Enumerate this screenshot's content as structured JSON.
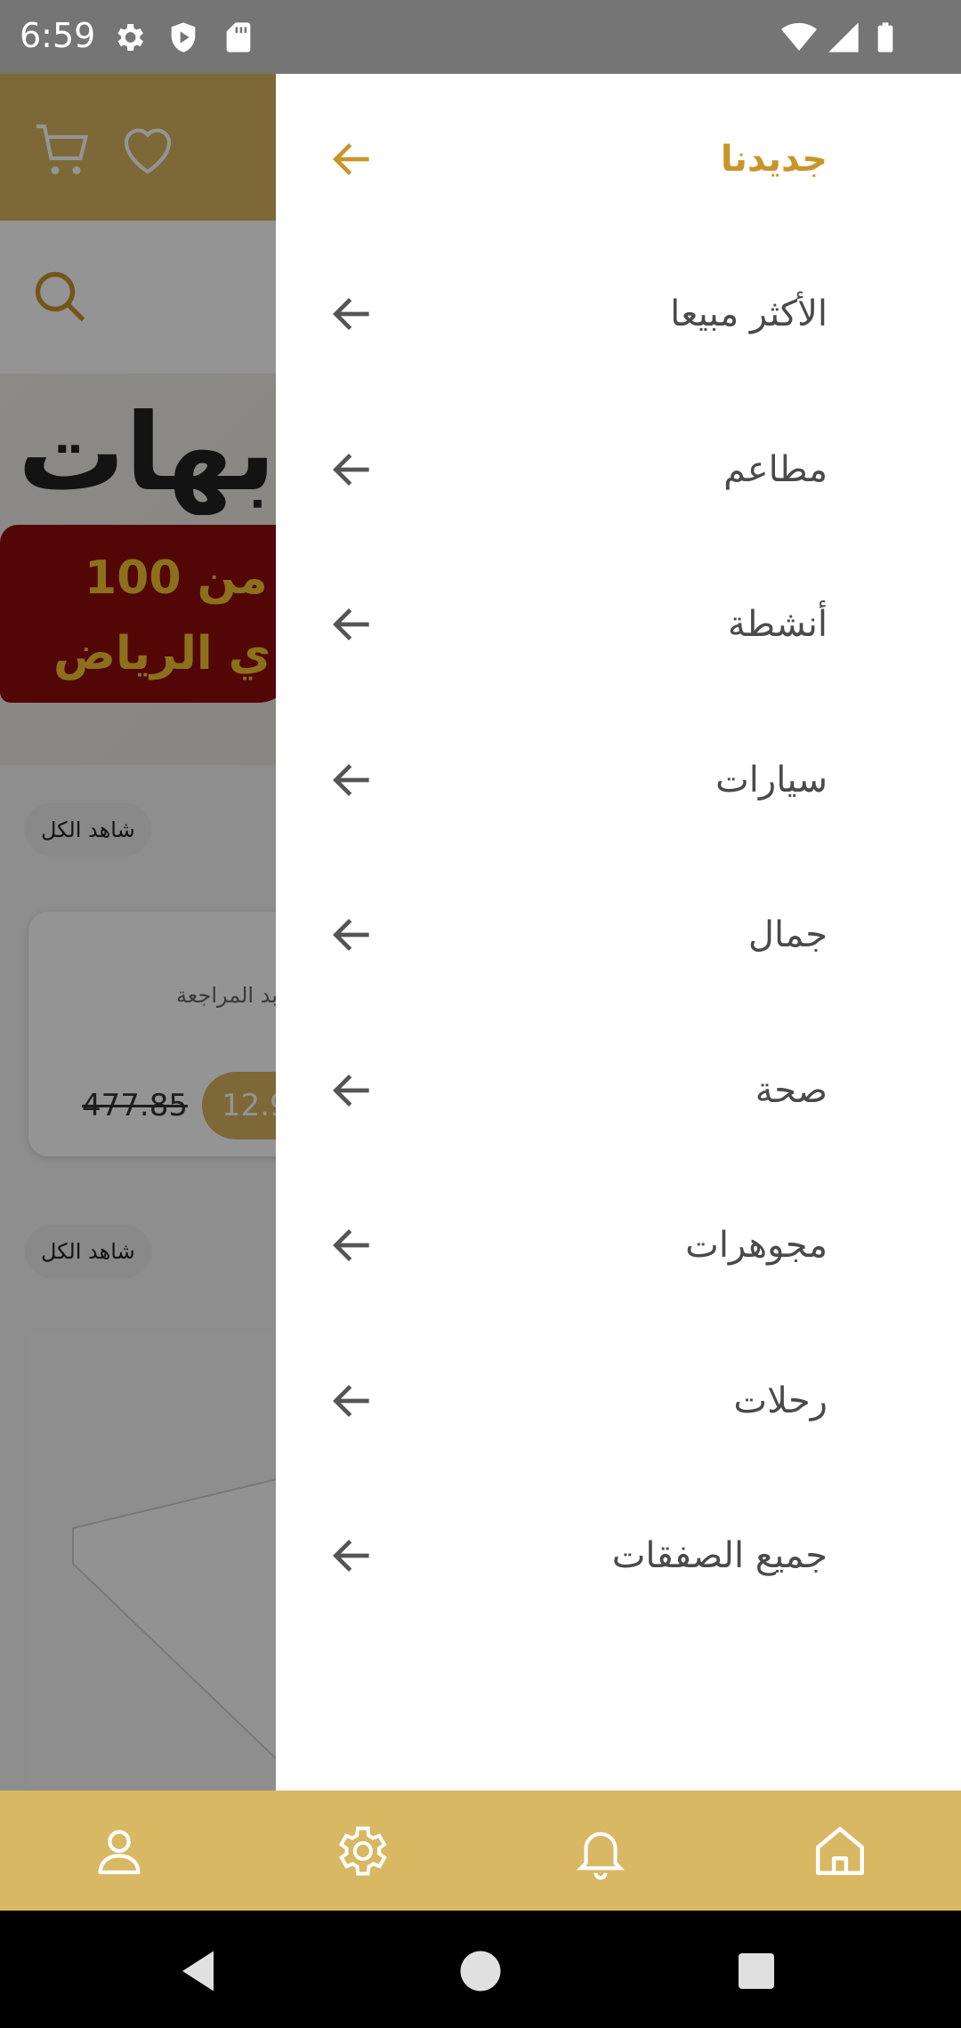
{
  "status_bar": {
    "time": "6:59",
    "icons": [
      "gear-icon",
      "shield-play-icon",
      "sd-card-icon",
      "wifi-icon",
      "signal-icon",
      "battery-icon"
    ]
  },
  "background": {
    "banner": {
      "title_fragment": "بهات",
      "line1": "من 100",
      "line2": "ي الرياض"
    },
    "see_all_1": "شاهد الكل",
    "see_all_2": "شاهد الكل",
    "card": {
      "text": "بد المراجعة",
      "old_price": "477.85",
      "price_badge": "12.9"
    }
  },
  "drawer": {
    "items": [
      {
        "label": "جديدنا",
        "active": true
      },
      {
        "label": "الأكثر مبيعا",
        "active": false
      },
      {
        "label": "مطاعم",
        "active": false
      },
      {
        "label": "أنشطة",
        "active": false
      },
      {
        "label": "سيارات",
        "active": false
      },
      {
        "label": "جمال",
        "active": false
      },
      {
        "label": "صحة",
        "active": false
      },
      {
        "label": "مجوهرات",
        "active": false
      },
      {
        "label": "رحلات",
        "active": false
      },
      {
        "label": "جميع الصفقات",
        "active": false
      }
    ]
  },
  "bottom_nav": {
    "items": [
      "profile-icon",
      "settings-icon",
      "notifications-icon",
      "home-icon"
    ]
  },
  "colors": {
    "brand": "#d9b864",
    "active_item": "#c9952a",
    "menu_text": "#4a4a4a",
    "status_bar": "#757575"
  }
}
